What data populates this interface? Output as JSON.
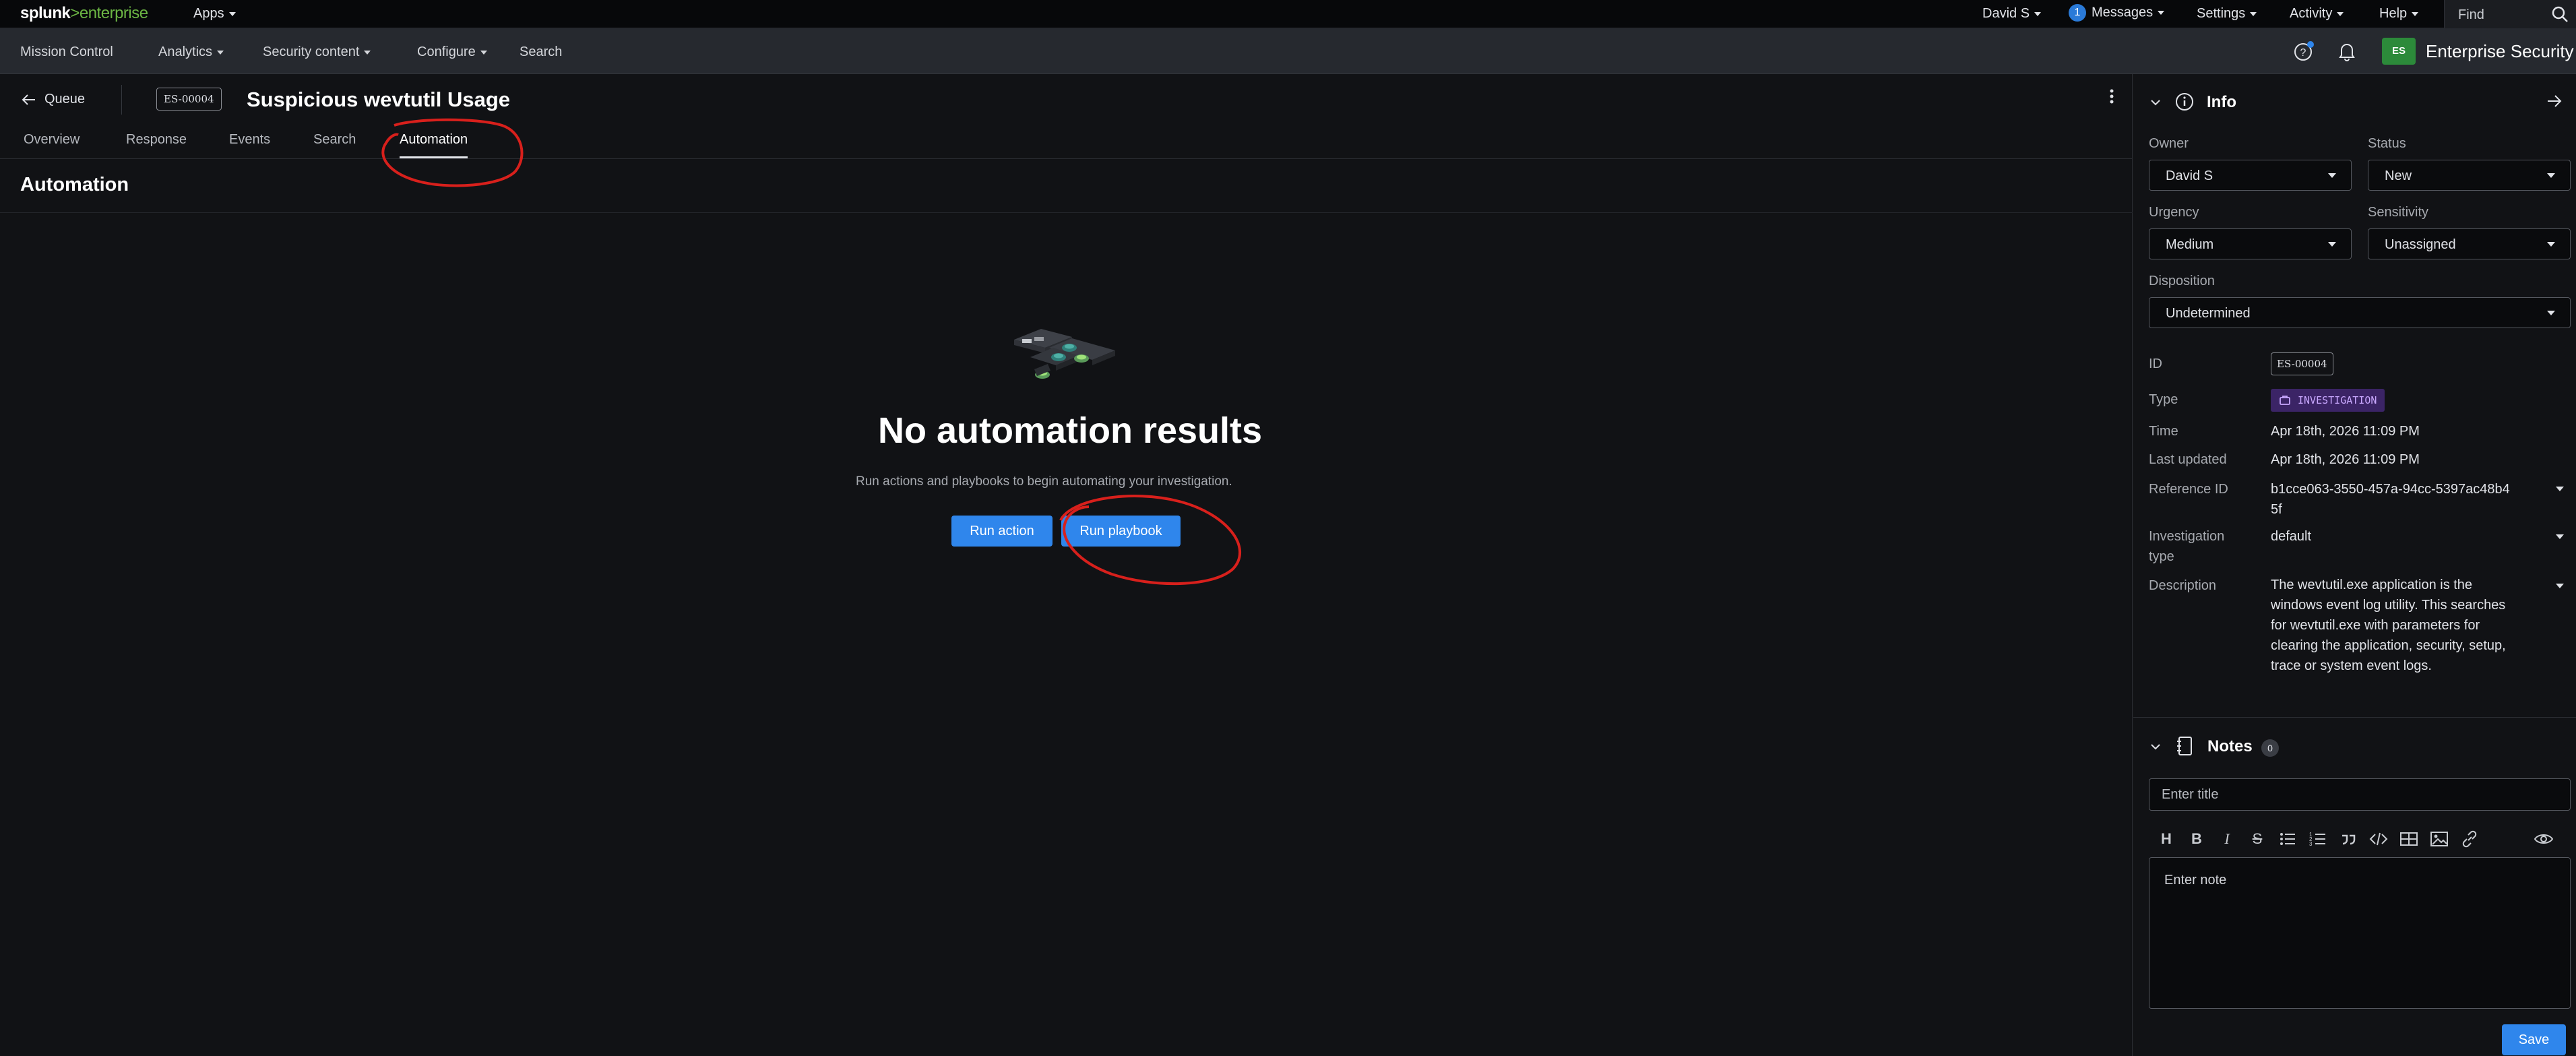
{
  "topbar": {
    "logo_main": "splunk",
    "logo_sep": ">",
    "logo_sub": "enterprise",
    "apps": "Apps",
    "user": "David S",
    "messages_count": "1",
    "messages": "Messages",
    "settings": "Settings",
    "activity": "Activity",
    "help": "Help",
    "find_placeholder": "Find"
  },
  "appbar": {
    "nav": [
      "Mission Control",
      "Analytics",
      "Security content",
      "Configure",
      "Search"
    ],
    "app_logo": "ES",
    "app_title": "Enterprise Security"
  },
  "incident": {
    "back_label": "Queue",
    "id": "ES-00004",
    "title": "Suspicious wevtutil Usage",
    "tabs": [
      "Overview",
      "Response",
      "Events",
      "Search",
      "Automation"
    ],
    "active_tab": "Automation",
    "section_title": "Automation"
  },
  "empty_state": {
    "title": "No automation results",
    "subtitle": "Run actions and playbooks to begin automating your investigation.",
    "run_action": "Run action",
    "run_playbook": "Run playbook"
  },
  "info_panel": {
    "title": "Info",
    "owner_label": "Owner",
    "owner_value": "David S",
    "status_label": "Status",
    "status_value": "New",
    "urgency_label": "Urgency",
    "urgency_value": "Medium",
    "sensitivity_label": "Sensitivity",
    "sensitivity_value": "Unassigned",
    "disposition_label": "Disposition",
    "disposition_value": "Undetermined",
    "id_label": "ID",
    "id_value": "ES-00004",
    "type_label": "Type",
    "type_value": "INVESTIGATION",
    "time_label": "Time",
    "time_value": "Apr 18th, 2026 11:09 PM",
    "last_updated_label": "Last updated",
    "last_updated_value": "Apr 18th, 2026 11:09 PM",
    "reference_id_label": "Reference ID",
    "reference_id_line1": "b1cce063-3550-457a-94cc-5397ac48b4",
    "reference_id_line2": "5f",
    "investigation_type_label_1": "Investigation",
    "investigation_type_label_2": "type",
    "investigation_type_value": "default",
    "description_label": "Description",
    "description_value": "The wevtutil.exe application is the windows event log utility. This searches for wevtutil.exe with parameters for clearing the application, security, setup, trace or system event logs."
  },
  "notes": {
    "title": "Notes",
    "count": "0",
    "title_placeholder": "Enter title",
    "note_placeholder": "Enter note",
    "save": "Save",
    "toolbar": [
      "H",
      "B",
      "I",
      "S"
    ]
  },
  "colors": {
    "accent": "#2f86ec",
    "annotation": "#d8201c",
    "splunk_green": "#6cb644",
    "type_badge_bg": "#3b2466"
  },
  "icons": [
    "search-icon",
    "question-icon",
    "bell-icon",
    "back-arrow-icon",
    "kebab-menu-icon",
    "info-icon",
    "collapse-arrow-icon",
    "notes-icon",
    "eye-icon",
    "briefcase-icon"
  ]
}
